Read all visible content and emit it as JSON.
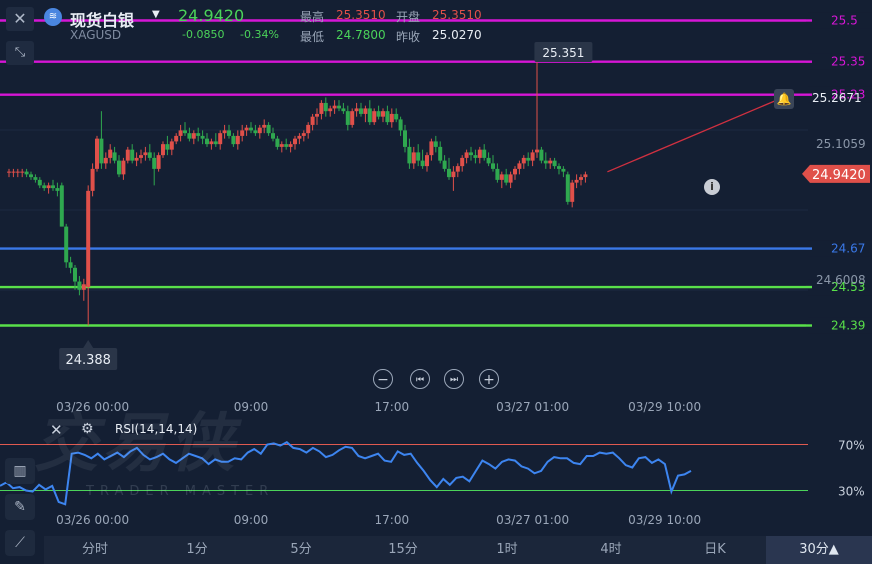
{
  "header": {
    "name": "现货白银",
    "symbol": "XAGUSD",
    "price": "24.9420",
    "change": "-0.0850",
    "change_pct": "-0.34%",
    "high_label": "最高",
    "high": "25.3510",
    "open_label": "开盘",
    "open": "25.3510",
    "low_label": "最低",
    "low": "24.7800",
    "prev_label": "昨收",
    "prev": "25.0270"
  },
  "watermark": {
    "brand": "交易侠",
    "sub": "TRADER MASTER"
  },
  "controls": {
    "zoom_out": "−",
    "prev": "⏮",
    "next": "⏭",
    "zoom_in": "+"
  },
  "tabs": [
    {
      "label": "分时"
    },
    {
      "label": "1分"
    },
    {
      "label": "5分"
    },
    {
      "label": "15分"
    },
    {
      "label": "1时"
    },
    {
      "label": "4时"
    },
    {
      "label": "日K"
    },
    {
      "label": "30分▲",
      "active": true
    }
  ],
  "colors": {
    "up": "#e0504a",
    "down": "#2fa84f",
    "magenta": "#d616d6",
    "blue": "#3a78e8",
    "green": "#59e04a",
    "rsi": "#3d85f0",
    "arrow": "#d03040"
  },
  "chart_data": {
    "type": "candlestick",
    "ylim": [
      24.33,
      25.56
    ],
    "x_ticks": [
      {
        "label": "03/26 00:00",
        "index": 19
      },
      {
        "label": "09:00",
        "index": 55
      },
      {
        "label": "17:00",
        "index": 87
      },
      {
        "label": "03/27 01:00",
        "index": 119
      },
      {
        "label": "03/29 10:00",
        "index": 149
      }
    ],
    "horizontal_lines": [
      {
        "value": 25.5,
        "label": "25.5",
        "color": "#d616d6"
      },
      {
        "value": 25.35,
        "label": "25.35",
        "color": "#d616d6"
      },
      {
        "value": 25.23,
        "label": "25.23",
        "color": "#d616d6"
      },
      {
        "value": 24.67,
        "label": "24.67",
        "color": "#3a78e8"
      },
      {
        "value": 24.53,
        "label": "24.53",
        "color": "#59e04a"
      },
      {
        "value": 24.39,
        "label": "24.39",
        "color": "#59e04a"
      }
    ],
    "y_axis_labels": [
      "25.2671",
      "25.1059",
      "24.6008"
    ],
    "current_price": "24.9420",
    "max_annotation": {
      "label": "25.351",
      "value": 25.351,
      "index": 126
    },
    "min_annotation": {
      "label": "24.388",
      "value": 24.388,
      "index": 18
    },
    "candles": [
      [
        24.95,
        24.96,
        24.93,
        24.95
      ],
      [
        24.95,
        24.96,
        24.93,
        24.95
      ],
      [
        24.95,
        24.96,
        24.93,
        24.95
      ],
      [
        24.95,
        24.96,
        24.93,
        24.95
      ],
      [
        24.95,
        24.96,
        24.93,
        24.94
      ],
      [
        24.94,
        24.95,
        24.92,
        24.93
      ],
      [
        24.93,
        24.94,
        24.91,
        24.92
      ],
      [
        24.92,
        24.93,
        24.89,
        24.9
      ],
      [
        24.9,
        24.91,
        24.88,
        24.89
      ],
      [
        24.89,
        24.91,
        24.87,
        24.9
      ],
      [
        24.9,
        24.92,
        24.88,
        24.89
      ],
      [
        24.89,
        24.91,
        24.86,
        24.88
      ],
      [
        24.9,
        24.91,
        24.75,
        24.75
      ],
      [
        24.75,
        24.76,
        24.6,
        24.62
      ],
      [
        24.62,
        24.64,
        24.58,
        24.6
      ],
      [
        24.6,
        24.61,
        24.52,
        24.55
      ],
      [
        24.55,
        24.57,
        24.5,
        24.52
      ],
      [
        24.52,
        24.56,
        24.48,
        24.54
      ],
      [
        24.53,
        24.9,
        24.39,
        24.88
      ],
      [
        24.88,
        24.98,
        24.86,
        24.96
      ],
      [
        24.96,
        25.08,
        24.95,
        25.07
      ],
      [
        25.07,
        25.17,
        24.96,
        24.98
      ],
      [
        24.98,
        25.02,
        24.96,
        25.0
      ],
      [
        25.0,
        25.05,
        24.98,
        25.03
      ],
      [
        25.02,
        25.04,
        24.98,
        24.99
      ],
      [
        24.99,
        25.01,
        24.93,
        24.94
      ],
      [
        24.94,
        25.0,
        24.92,
        24.99
      ],
      [
        24.99,
        25.04,
        24.98,
        25.03
      ],
      [
        25.03,
        25.05,
        24.98,
        24.99
      ],
      [
        24.99,
        25.02,
        24.97,
        25.0
      ],
      [
        25.0,
        25.03,
        24.98,
        25.01
      ],
      [
        25.01,
        25.04,
        24.99,
        25.02
      ],
      [
        25.02,
        25.05,
        24.99,
        25.0
      ],
      [
        25.0,
        25.02,
        24.9,
        24.96
      ],
      [
        24.96,
        25.02,
        24.95,
        25.01
      ],
      [
        25.01,
        25.06,
        25.0,
        25.05
      ],
      [
        25.05,
        25.08,
        25.01,
        25.03
      ],
      [
        25.03,
        25.07,
        25.01,
        25.06
      ],
      [
        25.06,
        25.09,
        25.05,
        25.08
      ],
      [
        25.08,
        25.12,
        25.06,
        25.1
      ],
      [
        25.1,
        25.13,
        25.08,
        25.09
      ],
      [
        25.09,
        25.11,
        25.06,
        25.07
      ],
      [
        25.07,
        25.1,
        25.05,
        25.09
      ],
      [
        25.09,
        25.11,
        25.06,
        25.08
      ],
      [
        25.08,
        25.1,
        25.05,
        25.07
      ],
      [
        25.07,
        25.09,
        25.04,
        25.05
      ],
      [
        25.05,
        25.07,
        25.03,
        25.06
      ],
      [
        25.06,
        25.09,
        25.04,
        25.05
      ],
      [
        25.05,
        25.1,
        25.03,
        25.09
      ],
      [
        25.09,
        25.12,
        25.07,
        25.1
      ],
      [
        25.1,
        25.12,
        25.07,
        25.08
      ],
      [
        25.08,
        25.09,
        25.04,
        25.05
      ],
      [
        25.05,
        25.1,
        25.03,
        25.08
      ],
      [
        25.08,
        25.12,
        25.06,
        25.1
      ],
      [
        25.1,
        25.12,
        25.08,
        25.11
      ],
      [
        25.11,
        25.13,
        25.09,
        25.1
      ],
      [
        25.1,
        25.12,
        25.08,
        25.09
      ],
      [
        25.09,
        25.12,
        25.07,
        25.11
      ],
      [
        25.11,
        25.14,
        25.09,
        25.12
      ],
      [
        25.12,
        25.13,
        25.08,
        25.09
      ],
      [
        25.09,
        25.11,
        25.06,
        25.07
      ],
      [
        25.07,
        25.08,
        25.03,
        25.04
      ],
      [
        25.04,
        25.06,
        25.02,
        25.05
      ],
      [
        25.05,
        25.07,
        25.03,
        25.04
      ],
      [
        25.04,
        25.06,
        25.02,
        25.05
      ],
      [
        25.05,
        25.08,
        25.03,
        25.07
      ],
      [
        25.07,
        25.09,
        25.05,
        25.08
      ],
      [
        25.08,
        25.1,
        25.06,
        25.09
      ],
      [
        25.09,
        25.13,
        25.07,
        25.12
      ],
      [
        25.12,
        25.16,
        25.1,
        25.15
      ],
      [
        25.15,
        25.18,
        25.12,
        25.16
      ],
      [
        25.16,
        25.21,
        25.14,
        25.2
      ],
      [
        25.2,
        25.22,
        25.15,
        25.17
      ],
      [
        25.17,
        25.19,
        25.15,
        25.18
      ],
      [
        25.18,
        25.21,
        25.16,
        25.19
      ],
      [
        25.19,
        25.21,
        25.17,
        25.18
      ],
      [
        25.18,
        25.2,
        25.16,
        25.17
      ],
      [
        25.17,
        25.19,
        25.1,
        25.12
      ],
      [
        25.12,
        25.18,
        25.11,
        25.17
      ],
      [
        25.17,
        25.2,
        25.15,
        25.18
      ],
      [
        25.18,
        25.2,
        25.15,
        25.16
      ],
      [
        25.16,
        25.19,
        25.13,
        25.18
      ],
      [
        25.18,
        25.21,
        25.12,
        25.13
      ],
      [
        25.13,
        25.18,
        25.12,
        25.17
      ],
      [
        25.17,
        25.19,
        25.14,
        25.15
      ],
      [
        25.15,
        25.18,
        25.13,
        25.17
      ],
      [
        25.17,
        25.19,
        25.12,
        25.13
      ],
      [
        25.13,
        25.18,
        25.11,
        25.16
      ],
      [
        25.16,
        25.18,
        25.13,
        25.14
      ],
      [
        25.14,
        25.15,
        25.08,
        25.1
      ],
      [
        25.1,
        25.12,
        25.02,
        25.04
      ],
      [
        25.04,
        25.07,
        24.96,
        24.98
      ],
      [
        24.98,
        25.04,
        24.96,
        25.02
      ],
      [
        25.02,
        25.05,
        24.97,
        24.99
      ],
      [
        24.99,
        25.03,
        24.96,
        24.97
      ],
      [
        24.97,
        25.02,
        24.95,
        25.01
      ],
      [
        25.01,
        25.07,
        24.99,
        25.06
      ],
      [
        25.06,
        25.08,
        25.02,
        25.04
      ],
      [
        25.04,
        25.06,
        24.98,
        24.99
      ],
      [
        24.99,
        25.01,
        24.95,
        24.96
      ],
      [
        24.96,
        25.0,
        24.92,
        24.93
      ],
      [
        24.93,
        24.97,
        24.88,
        24.95
      ],
      [
        24.95,
        24.98,
        24.93,
        24.97
      ],
      [
        24.97,
        25.01,
        24.95,
        25.0
      ],
      [
        25.0,
        25.03,
        24.98,
        25.02
      ],
      [
        25.02,
        25.04,
        24.99,
        25.01
      ],
      [
        25.01,
        25.03,
        24.98,
        25.0
      ],
      [
        25.0,
        25.04,
        24.98,
        25.03
      ],
      [
        25.03,
        25.05,
        24.99,
        25.0
      ],
      [
        25.0,
        25.02,
        24.97,
        24.98
      ],
      [
        24.98,
        25.01,
        24.95,
        24.96
      ],
      [
        24.96,
        24.98,
        24.91,
        24.92
      ],
      [
        24.92,
        24.95,
        24.89,
        24.94
      ],
      [
        24.94,
        24.96,
        24.9,
        24.91
      ],
      [
        24.91,
        24.95,
        24.89,
        24.94
      ],
      [
        24.94,
        24.97,
        24.92,
        24.96
      ],
      [
        24.96,
        24.99,
        24.94,
        24.98
      ],
      [
        24.98,
        25.01,
        24.96,
        25.0
      ],
      [
        25.0,
        25.02,
        24.97,
        24.99
      ],
      [
        24.99,
        25.03,
        24.97,
        25.02
      ],
      [
        25.02,
        25.35,
        25.0,
        25.03
      ],
      [
        25.03,
        25.04,
        24.98,
        24.99
      ],
      [
        24.99,
        25.02,
        24.96,
        24.98
      ],
      [
        24.98,
        25.0,
        24.96,
        24.99
      ],
      [
        24.99,
        25.0,
        24.96,
        24.97
      ],
      [
        24.97,
        24.98,
        24.94,
        24.96
      ],
      [
        24.96,
        24.97,
        24.93,
        24.95
      ],
      [
        24.94,
        24.95,
        24.83,
        24.84
      ],
      [
        24.84,
        24.92,
        24.82,
        24.91
      ],
      [
        24.91,
        24.94,
        24.89,
        24.92
      ],
      [
        24.92,
        24.94,
        24.9,
        24.93
      ],
      [
        24.93,
        24.95,
        24.91,
        24.94
      ]
    ],
    "rsi": {
      "label": "RSI(14,14,14)",
      "levels": [
        {
          "value": 70,
          "label": "70%"
        },
        {
          "value": 30,
          "label": "30%"
        }
      ],
      "ylim": [
        0,
        100
      ],
      "values": [
        34,
        37,
        32,
        33,
        30,
        29,
        35,
        31,
        34,
        20,
        18,
        62,
        63,
        61,
        58,
        62,
        57,
        60,
        63,
        59,
        64,
        67,
        61,
        57,
        59,
        62,
        57,
        54,
        58,
        62,
        60,
        58,
        53,
        57,
        55,
        55,
        58,
        57,
        63,
        66,
        62,
        70,
        71,
        69,
        72,
        67,
        66,
        63,
        67,
        64,
        59,
        61,
        65,
        68,
        67,
        60,
        58,
        60,
        62,
        56,
        55,
        64,
        61,
        62,
        54,
        47,
        39,
        33,
        40,
        35,
        41,
        42,
        38,
        47,
        56,
        53,
        49,
        55,
        57,
        56,
        51,
        49,
        45,
        47,
        55,
        59,
        58,
        58,
        54,
        53,
        60,
        60,
        63,
        62,
        63,
        58,
        52,
        50,
        58,
        59,
        54,
        57,
        53,
        29,
        43,
        44,
        47
      ]
    }
  }
}
